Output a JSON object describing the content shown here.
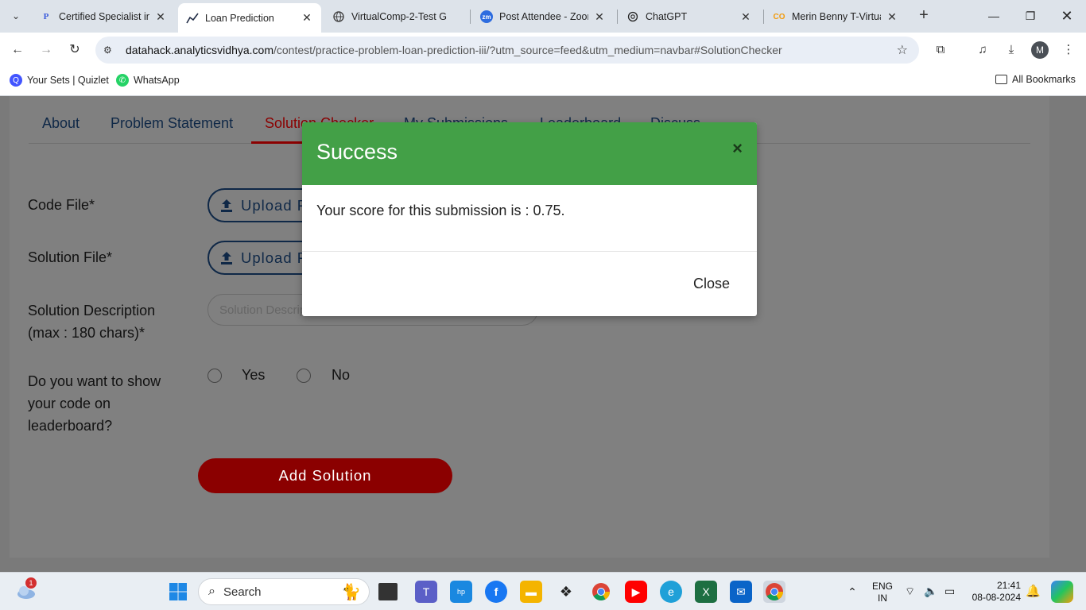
{
  "browser": {
    "tabs": [
      {
        "title": "Certified Specialist in",
        "favicon": "P"
      },
      {
        "title": "Loan Prediction",
        "favicon": "chart-line-icon",
        "active": true
      },
      {
        "title": "VirtualComp-2-Test G",
        "favicon": "globe-icon"
      },
      {
        "title": "Post Attendee - Zoom",
        "favicon": "zm"
      },
      {
        "title": "ChatGPT",
        "favicon": "chatgpt-icon"
      },
      {
        "title": "Merin Benny T-Virtua",
        "favicon": "CO"
      }
    ],
    "url_domain": "datahack.analyticsvidhya.com",
    "url_path": "/contest/practice-problem-loan-prediction-iii/?utm_source=feed&utm_medium=navbar#SolutionChecker",
    "profile_initial": "M",
    "bookmarks": [
      {
        "label": "Your Sets | Quizlet"
      },
      {
        "label": "WhatsApp"
      }
    ],
    "all_bookmarks_label": "All Bookmarks"
  },
  "page": {
    "nav_tabs": [
      "About",
      "Problem Statement",
      "Solution Checker",
      "My Submissions",
      "Leaderboard",
      "Discuss"
    ],
    "code_file_label": "Code File*",
    "solution_file_label": "Solution File*",
    "upload_label": "Upload File",
    "description_label_1": "Solution Description",
    "description_label_2": "(max : 180 chars)*",
    "description_placeholder": "Solution Description (optional)",
    "show_code_label_1": "Do you want to show",
    "show_code_label_2": "your code on",
    "show_code_label_3": "leaderboard?",
    "yes_label": "Yes",
    "no_label": "No",
    "add_solution_label": "Add Solution"
  },
  "modal": {
    "title": "Success",
    "message": "Your score for this submission is : 0.75.",
    "close_label": "Close",
    "header_color": "#43a047"
  },
  "taskbar": {
    "search_placeholder": "Search",
    "weather_badge": "1",
    "lang_1": "ENG",
    "lang_2": "IN",
    "time": "21:41",
    "date": "08-08-2024"
  },
  "colors": {
    "accent_red": "#8b0000",
    "navy": "#0f2847",
    "overlay": "#808080"
  }
}
